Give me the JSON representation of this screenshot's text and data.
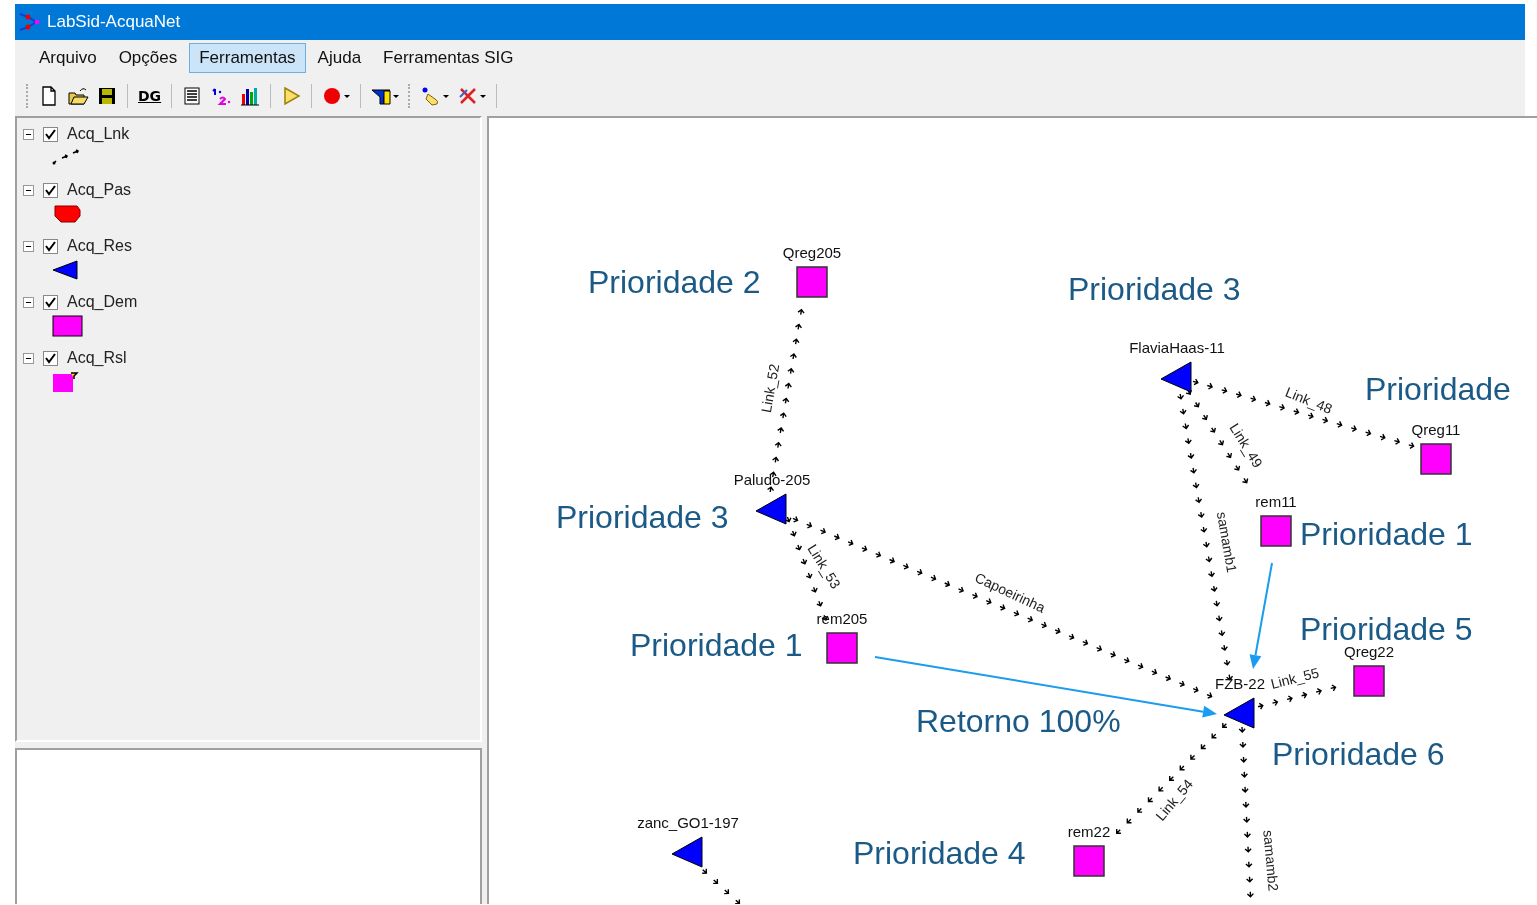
{
  "window": {
    "title": "LabSid-AcquaNet"
  },
  "menu": [
    {
      "label": "Arquivo",
      "selected": false
    },
    {
      "label": "Opções",
      "selected": false
    },
    {
      "label": "Ferramentas",
      "selected": true
    },
    {
      "label": "Ajuda",
      "selected": false
    },
    {
      "label": "Ferramentas SIG",
      "selected": false
    }
  ],
  "toolbar": {
    "dg_label": "DG"
  },
  "layers": [
    {
      "name": "Acq_Lnk",
      "kind": "link",
      "checked": true,
      "expanded": true
    },
    {
      "name": "Acq_Pas",
      "kind": "passage",
      "checked": true,
      "expanded": true
    },
    {
      "name": "Acq_Res",
      "kind": "reservoir",
      "checked": true,
      "expanded": true
    },
    {
      "name": "Acq_Dem",
      "kind": "demand",
      "checked": true,
      "expanded": true
    },
    {
      "name": "Acq_Rsl",
      "kind": "return",
      "checked": true,
      "expanded": true
    }
  ],
  "network": {
    "nodes": [
      {
        "kind": "demand",
        "label": "Qreg205"
      },
      {
        "kind": "reservoir",
        "label": "Paludo-205"
      },
      {
        "kind": "demand",
        "label": "rem205"
      },
      {
        "kind": "reservoir",
        "label": "FlaviaHaas-11"
      },
      {
        "kind": "demand",
        "label": "Qreg11"
      },
      {
        "kind": "demand",
        "label": "rem11"
      },
      {
        "kind": "reservoir",
        "label": "FZB-22"
      },
      {
        "kind": "demand",
        "label": "Qreg22"
      },
      {
        "kind": "demand",
        "label": "rem22"
      },
      {
        "kind": "reservoir",
        "label": "zanc_GO1-197"
      }
    ],
    "links": [
      {
        "label": "Link_52"
      },
      {
        "label": "Link_53"
      },
      {
        "label": "Capoeirinha"
      },
      {
        "label": "Link_48"
      },
      {
        "label": "Link_49"
      },
      {
        "label": "samamb1"
      },
      {
        "label": "Link_55"
      },
      {
        "label": "Link_54"
      },
      {
        "label": "samamb2"
      }
    ],
    "annotations": [
      {
        "text": "Prioridade 2"
      },
      {
        "text": "Prioridade 3"
      },
      {
        "text": "Prioridade"
      },
      {
        "text": "Prioridade 3"
      },
      {
        "text": "Prioridade 1"
      },
      {
        "text": "Prioridade 5"
      },
      {
        "text": "Prioridade 1"
      },
      {
        "text": "Retorno 100%"
      },
      {
        "text": "Prioridade 6"
      },
      {
        "text": "Prioridade 4"
      }
    ]
  }
}
